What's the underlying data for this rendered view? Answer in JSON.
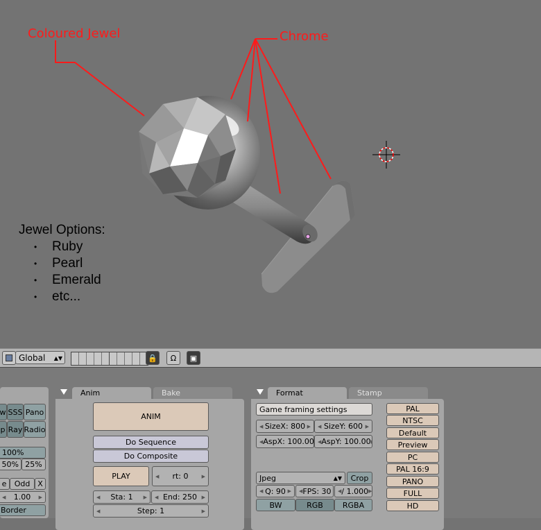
{
  "viewport": {
    "annotations": {
      "coloured_jewel": "Coloured Jewel",
      "chrome": "Chrome"
    },
    "jewel_options": {
      "title": "Jewel Options:",
      "items": [
        "Ruby",
        "Pearl",
        "Emerald",
        "etc..."
      ]
    },
    "colors": {
      "annotation": "#ff1a1a",
      "background": "#737373"
    }
  },
  "header": {
    "orientation_select": "Global"
  },
  "left_panel": {
    "row1": [
      "w",
      "SSS",
      "Pano"
    ],
    "row2": [
      "p",
      "Ray",
      "Radio"
    ],
    "row3": [
      "100%"
    ],
    "row4": [
      "50%",
      "25%"
    ],
    "row5": [
      "e",
      "Odd",
      "X"
    ],
    "row6_value": "1.00",
    "row7": "Border"
  },
  "anim_panel": {
    "tabs": [
      "Anim",
      "Bake"
    ],
    "anim_button": "ANIM",
    "do_sequence": "Do Sequence",
    "do_composite": "Do Composite",
    "play": "PLAY",
    "rt": "rt: 0",
    "sta": "Sta: 1",
    "end": "End: 250",
    "step": "Step: 1"
  },
  "format_panel": {
    "tabs": [
      "Format",
      "Stamp"
    ],
    "game_framing": "Game framing settings",
    "size_x": "SizeX: 800",
    "size_y": "SizeY: 600",
    "asp_x": "AspX: 100.00",
    "asp_y": "AspY: 100.00",
    "file_type": "Jpeg",
    "crop": "Crop",
    "quality": "Q: 90",
    "fps": "FPS: 30",
    "fps_base": "/ 1.000",
    "bw": "BW",
    "rgb": "RGB",
    "rgba": "RGBA",
    "presets": [
      "PAL",
      "NTSC",
      "Default",
      "Preview",
      "PC",
      "PAL 16:9",
      "PANO",
      "FULL",
      "HD"
    ]
  }
}
